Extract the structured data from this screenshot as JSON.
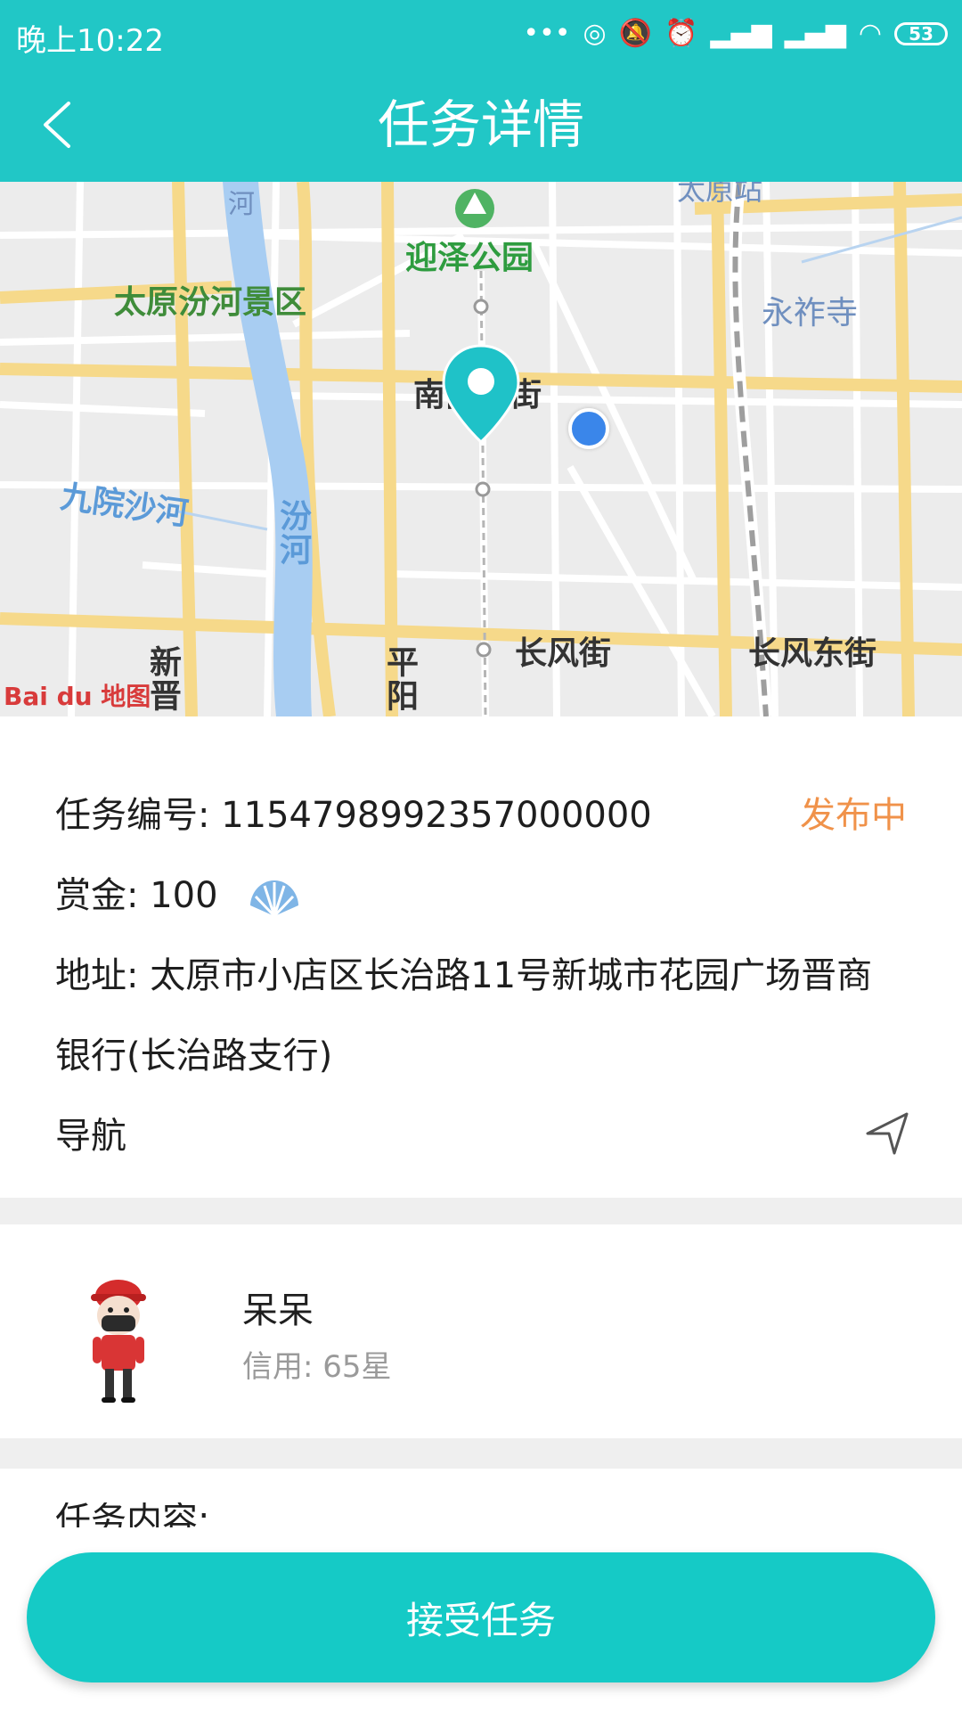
{
  "status_bar": {
    "time": "晚上10:22",
    "battery": "53",
    "icons": [
      "more-icon",
      "hotspot-icon",
      "mute-icon",
      "alarm-icon",
      "signal-icon",
      "signal-icon",
      "wifi-icon",
      "battery-icon"
    ]
  },
  "header": {
    "title": "任务详情",
    "back_icon": "chevron-left-icon",
    "background_color": "#21c7c6"
  },
  "map": {
    "labels": {
      "park": "迎泽公园",
      "scenic": "太原汾河景区",
      "temple": "永祚寺",
      "river_sha": "九院沙河",
      "river_fen": "汾河",
      "street_nannei": "南内环街",
      "street_changfeng": "长风街",
      "street_changfeng_east": "长风东街",
      "district_xinjin": "新晋",
      "district_pingyang": "平阳",
      "top_cut_he": "河",
      "top_cut_station": "太原站"
    },
    "provider_logo": "Bai du 地图"
  },
  "task": {
    "id_label": "任务编号:",
    "id_value": "1154798992357000000",
    "status": "发布中",
    "reward_label": "赏金:",
    "reward_value": "100",
    "reward_icon": "shell-icon",
    "address_label": "地址:",
    "address_line1": "太原市小店区长治路11号新城市花园广场晋商",
    "address_line2": "银行(长治路支行)",
    "navigation_label": "导航",
    "navigation_icon": "navigate-arrow-icon",
    "status_color": "#f0924a"
  },
  "user": {
    "name": "呆呆",
    "credit": "信用: 65星"
  },
  "content": {
    "label": "任务内容:"
  },
  "actions": {
    "accept_label": "接受任务",
    "accent_color": "#15cac6"
  }
}
